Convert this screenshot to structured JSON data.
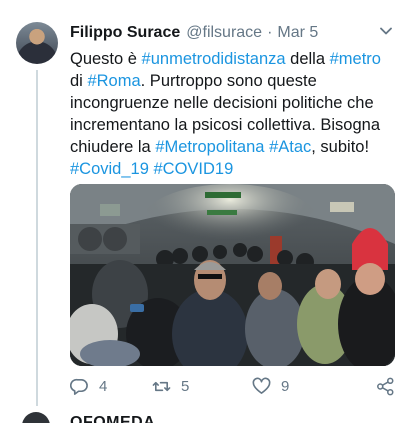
{
  "tweet": {
    "author_name": "Filippo Surace",
    "handle": "@filsurace",
    "separator": "·",
    "date": "Mar 5",
    "text_parts": [
      {
        "t": "Questo è ",
        "link": false
      },
      {
        "t": "#unmetrodidistanza",
        "link": true
      },
      {
        "t": " della ",
        "link": false
      },
      {
        "t": "#metro",
        "link": true
      },
      {
        "t": " di ",
        "link": false
      },
      {
        "t": "#Roma",
        "link": true
      },
      {
        "t": ". Purtroppo sono queste incongruenze nelle decisioni politiche che incrementano la psicosi collettiva. Bisogna chiudere la ",
        "link": false
      },
      {
        "t": "#Metropolitana",
        "link": true
      },
      {
        "t": " ",
        "link": false
      },
      {
        "t": "#Atac",
        "link": true
      },
      {
        "t": ", subito! ",
        "link": false
      },
      {
        "t": "#Covid_19",
        "link": true
      },
      {
        "t": " ",
        "link": false
      },
      {
        "t": "#COVID19",
        "link": true
      }
    ],
    "media_alt": "crowded metro platform photo",
    "actions": {
      "reply_count": "4",
      "retweet_count": "5",
      "like_count": "9"
    }
  },
  "next_tweet": {
    "author_partial": "OFOMEDA"
  },
  "colors": {
    "link": "#1b95e0",
    "secondary_text": "#657786",
    "primary_text": "#14171a"
  },
  "icons": [
    "chevron-down-icon",
    "reply-icon",
    "retweet-icon",
    "like-icon",
    "share-icon"
  ]
}
